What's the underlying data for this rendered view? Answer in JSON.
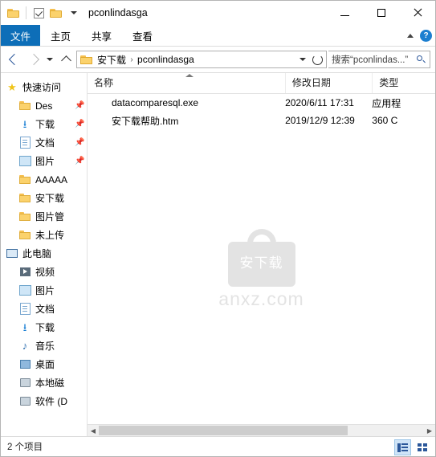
{
  "window": {
    "title": "pconlindasga",
    "minimize_label": "—",
    "maximize_label": "□",
    "close_label": "✕"
  },
  "quick_access_toolbar": {
    "items": [
      {
        "name": "folder-icon",
        "label": ""
      },
      {
        "name": "checkbox-icon",
        "label": ""
      },
      {
        "name": "folder-icon-2",
        "label": ""
      },
      {
        "name": "customize-dropdown",
        "label": "▾"
      }
    ]
  },
  "ribbon": {
    "tabs": [
      {
        "id": "file",
        "label": "文件"
      },
      {
        "id": "home",
        "label": "主页"
      },
      {
        "id": "share",
        "label": "共享"
      },
      {
        "id": "view",
        "label": "查看"
      }
    ],
    "collapse_label": "⌃",
    "help_label": "?"
  },
  "address_bar": {
    "back_label": "‹",
    "forward_label": "›",
    "recent_label": "⌄",
    "up_label": "↑",
    "breadcrumbs": [
      "安下载",
      "pconlindasga"
    ],
    "separator": "›",
    "dropdown_label": "⌄",
    "refresh_label": "↻",
    "search_placeholder": "搜索“pconlindas...”"
  },
  "nav_pane": {
    "items": [
      {
        "label": "快速访问",
        "icon": "star-icon",
        "indent": false,
        "pinned": false
      },
      {
        "label": "Des",
        "icon": "folder-icon",
        "indent": true,
        "pinned": true
      },
      {
        "label": "下载",
        "icon": "download-icon",
        "indent": true,
        "pinned": true
      },
      {
        "label": "文档",
        "icon": "document-icon",
        "indent": true,
        "pinned": true
      },
      {
        "label": "图片",
        "icon": "picture-icon",
        "indent": true,
        "pinned": true
      },
      {
        "label": "AAAAA",
        "icon": "folder-icon",
        "indent": true,
        "pinned": false
      },
      {
        "label": "安下载",
        "icon": "folder-icon",
        "indent": true,
        "pinned": false
      },
      {
        "label": "图片管",
        "icon": "folder-icon",
        "indent": true,
        "pinned": false
      },
      {
        "label": "未上传",
        "icon": "folder-icon",
        "indent": true,
        "pinned": false
      },
      {
        "label": "此电脑",
        "icon": "pc-icon",
        "indent": false,
        "pinned": false
      },
      {
        "label": "视频",
        "icon": "video-icon",
        "indent": true,
        "pinned": false
      },
      {
        "label": "图片",
        "icon": "picture-icon",
        "indent": true,
        "pinned": false
      },
      {
        "label": "文档",
        "icon": "document-icon",
        "indent": true,
        "pinned": false
      },
      {
        "label": "下载",
        "icon": "download-icon",
        "indent": true,
        "pinned": false
      },
      {
        "label": "音乐",
        "icon": "music-icon",
        "indent": true,
        "pinned": false
      },
      {
        "label": "桌面",
        "icon": "desktop-icon",
        "indent": true,
        "pinned": false
      },
      {
        "label": "本地磁",
        "icon": "disk-icon",
        "indent": true,
        "pinned": false
      },
      {
        "label": "软件 (D",
        "icon": "disk-icon",
        "indent": true,
        "pinned": false
      }
    ]
  },
  "file_list": {
    "columns": [
      {
        "id": "name",
        "label": "名称",
        "sorted": true
      },
      {
        "id": "date",
        "label": "修改日期",
        "sorted": false
      },
      {
        "id": "type",
        "label": "类型",
        "sorted": false
      }
    ],
    "rows": [
      {
        "name": "datacomparesql.exe",
        "date": "2020/6/11 17:31",
        "type": "应用程",
        "icon": "exe-file-icon"
      },
      {
        "name": "安下载帮助.htm",
        "date": "2019/12/9 12:39",
        "type": "360 C",
        "icon": "htm-file-icon"
      }
    ]
  },
  "watermark": {
    "badge_text": "安下载",
    "caption": "anxz.com"
  },
  "scrollbar": {
    "left_arrow": "◀",
    "right_arrow": "▶"
  },
  "status_bar": {
    "item_count": "2 个项目",
    "details_view_label": "",
    "tiles_view_label": ""
  },
  "colors": {
    "file_tab": "#0d6eb8",
    "accent": "#2b579a",
    "selection": "#cfe4f7"
  }
}
